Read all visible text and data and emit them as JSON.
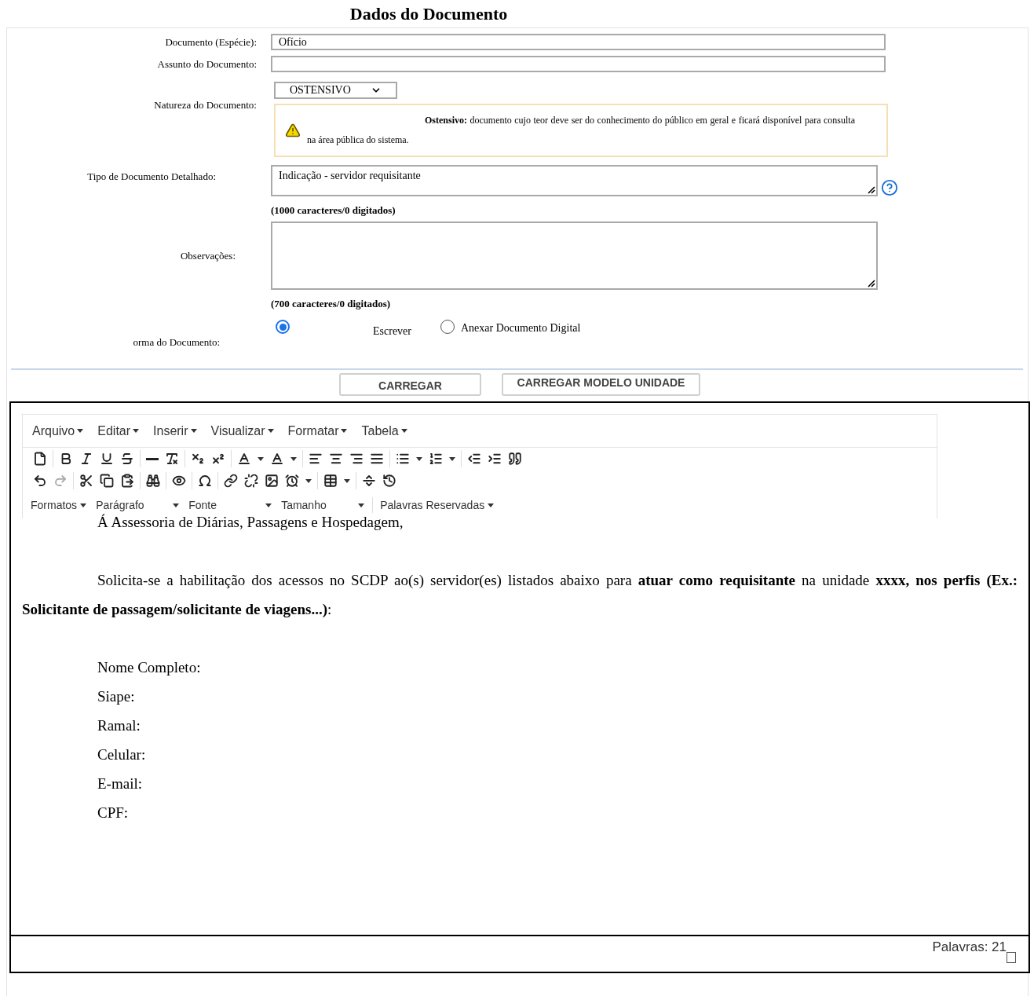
{
  "title": "Dados do Documento",
  "form": {
    "especie": {
      "label": "Documento (Espécie):",
      "value": "Ofício"
    },
    "assunto": {
      "label": "Assunto do Documento:"
    },
    "natureza": {
      "label": "Natureza do Documento:",
      "value": "OSTENSIVO",
      "notice": "**Ostensivo:** documento cujo teor deve ser do conhecimento do público em geral e ficará disponível para consulta na área pública do sistema."
    },
    "tipo": {
      "label": "Tipo de Documento Detalhado:",
      "value": "Indicação - servidor requisitante",
      "counter": "(1000 caracteres/0 digitados)"
    },
    "observacoes": {
      "label": "Observações:",
      "counter": "(700 caracteres/0 digitados)"
    },
    "forma": {
      "label": "orma do Documento:",
      "options": [
        {
          "label": "Escrever",
          "selected": true
        },
        {
          "label": "Anexar Documento Digital",
          "selected": false
        }
      ]
    }
  },
  "buttons": [
    "CARREGAR",
    "CARREGAR MODELO UNIDADE"
  ],
  "editor": {
    "menus": [
      "Arquivo",
      "Editar",
      "Inserir",
      "Visualizar",
      "Formatar",
      "Tabela"
    ],
    "toolbar_rows": [
      [
        [
          {
            "kind": "new",
            "disabled": false
          }
        ],
        [
          {
            "kind": "bold",
            "disabled": false
          },
          {
            "kind": "italic",
            "disabled": false
          },
          {
            "kind": "underline",
            "disabled": false
          },
          {
            "kind": "strike",
            "disabled": false
          }
        ],
        [
          {
            "kind": "hr",
            "disabled": false
          },
          {
            "kind": "clear",
            "disabled": false
          }
        ],
        [
          {
            "kind": "sub",
            "disabled": false
          },
          {
            "kind": "sup",
            "disabled": false
          }
        ],
        [
          {
            "kind": "forecolor",
            "disabled": false
          },
          {
            "kind": "backcolor",
            "disabled": false
          }
        ],
        [
          {
            "kind": "left",
            "disabled": false
          },
          {
            "kind": "center",
            "disabled": false
          },
          {
            "kind": "right",
            "disabled": false
          },
          {
            "kind": "justify",
            "disabled": false
          }
        ],
        [
          {
            "kind": "bullets",
            "disabled": false
          },
          {
            "kind": "numbers",
            "disabled": false
          }
        ],
        [
          {
            "kind": "outdent",
            "disabled": false
          },
          {
            "kind": "indent",
            "disabled": false
          },
          {
            "kind": "quote",
            "disabled": false
          }
        ]
      ],
      [
        [
          {
            "kind": "undo",
            "disabled": false
          },
          {
            "kind": "redo",
            "disabled": true
          }
        ],
        [
          {
            "kind": "cut",
            "disabled": false
          },
          {
            "kind": "copy",
            "disabled": false
          },
          {
            "kind": "paste",
            "disabled": false
          }
        ],
        [
          {
            "kind": "find",
            "disabled": false
          }
        ],
        [
          {
            "kind": "preview",
            "disabled": false
          }
        ],
        [
          {
            "kind": "charmap",
            "disabled": false
          }
        ],
        [
          {
            "kind": "link",
            "disabled": false
          },
          {
            "kind": "unlink",
            "disabled": false
          },
          {
            "kind": "image",
            "disabled": false
          },
          {
            "kind": "datetime",
            "disabled": false
          }
        ],
        [
          {
            "kind": "table",
            "disabled": false
          }
        ],
        [
          {
            "kind": "pagebreak",
            "disabled": false
          },
          {
            "kind": "restore",
            "disabled": false
          }
        ]
      ]
    ],
    "dropdowns": [
      {
        "label": "Formatos",
        "wide": false
      },
      {
        "label": "Parágrafo",
        "wide": true
      },
      {
        "label": "Fonte",
        "wide": true
      },
      {
        "label": "Tamanho",
        "wide": true
      },
      {
        "label": "Palavras Reservadas",
        "wide": false
      }
    ],
    "content": [
      {
        "kind": "line",
        "text": "Á Assessoria de Diárias, Passagens e Hospedagem,"
      },
      {
        "kind": "blank"
      },
      {
        "kind": "paragraph",
        "text": "Solicita-se a habilitação dos acessos no SCDP ao(s) servidor(es) listados abaixo para **atuar como requisitante** na unidade **xxxx, nos perfis (Ex.: Solicitante de passagem/solicitante de viagens...)**:"
      },
      {
        "kind": "blank"
      },
      {
        "kind": "line",
        "text": "Nome Completo:"
      },
      {
        "kind": "line",
        "text": "Siape:"
      },
      {
        "kind": "line",
        "text": "Ramal:"
      },
      {
        "kind": "line",
        "text": "Celular:"
      },
      {
        "kind": "line",
        "text": "E-mail:"
      },
      {
        "kind": "line",
        "text": "CPF:"
      }
    ],
    "word_count": "Palavras: 21"
  }
}
